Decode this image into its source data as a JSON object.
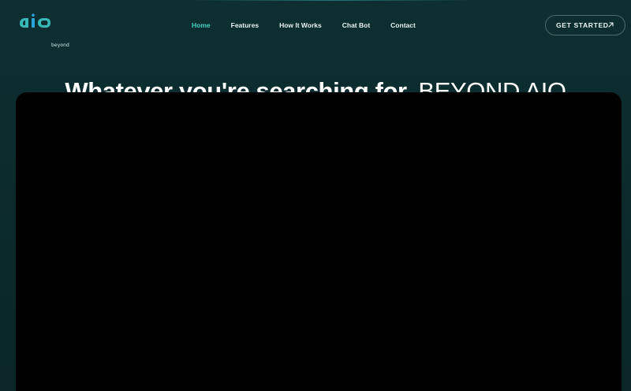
{
  "header": {
    "logo": {
      "wordmark": "aio",
      "sub": "beyond",
      "colors": {
        "primary": "#36b9b7",
        "accent": "#2aa3d8"
      }
    },
    "nav": {
      "items": [
        {
          "label": "Home",
          "active": true
        },
        {
          "label": "Features",
          "active": false
        },
        {
          "label": "How It Works",
          "active": false
        },
        {
          "label": "Chat Bot",
          "active": false
        },
        {
          "label": "Contact",
          "active": false
        }
      ]
    },
    "cta": {
      "label": "GET STARTED",
      "icon": "arrow-up-right-icon"
    }
  },
  "hero": {
    "title_lead": "Whatever you're searching for,",
    "title_brand": "BEYOND AIO"
  },
  "theme": {
    "background": "#0c2b2e",
    "active_nav": "#45d1c1",
    "media_panel": "#000000"
  }
}
